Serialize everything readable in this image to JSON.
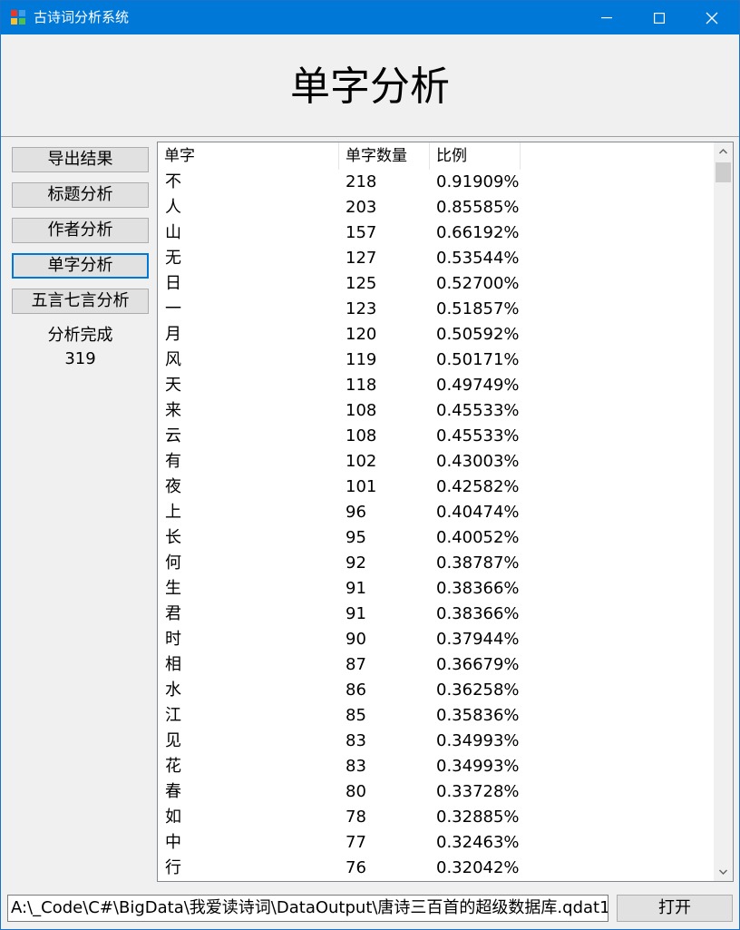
{
  "window": {
    "title": "古诗词分析系统"
  },
  "header": {
    "title": "单字分析"
  },
  "sidebar": {
    "buttons": [
      {
        "label": "导出结果"
      },
      {
        "label": "标题分析"
      },
      {
        "label": "作者分析"
      },
      {
        "label": "单字分析"
      },
      {
        "label": "五言七言分析"
      }
    ],
    "status_text": "分析完成",
    "status_count": "319"
  },
  "table": {
    "columns": [
      "单字",
      "单字数量",
      "比例"
    ],
    "rows": [
      [
        "不",
        "218",
        "0.91909%"
      ],
      [
        "人",
        "203",
        "0.85585%"
      ],
      [
        "山",
        "157",
        "0.66192%"
      ],
      [
        "无",
        "127",
        "0.53544%"
      ],
      [
        "日",
        "125",
        "0.52700%"
      ],
      [
        "一",
        "123",
        "0.51857%"
      ],
      [
        "月",
        "120",
        "0.50592%"
      ],
      [
        "风",
        "119",
        "0.50171%"
      ],
      [
        "天",
        "118",
        "0.49749%"
      ],
      [
        "来",
        "108",
        "0.45533%"
      ],
      [
        "云",
        "108",
        "0.45533%"
      ],
      [
        "有",
        "102",
        "0.43003%"
      ],
      [
        "夜",
        "101",
        "0.42582%"
      ],
      [
        "上",
        "96",
        "0.40474%"
      ],
      [
        "长",
        "95",
        "0.40052%"
      ],
      [
        "何",
        "92",
        "0.38787%"
      ],
      [
        "生",
        "91",
        "0.38366%"
      ],
      [
        "君",
        "91",
        "0.38366%"
      ],
      [
        "时",
        "90",
        "0.37944%"
      ],
      [
        "相",
        "87",
        "0.36679%"
      ],
      [
        "水",
        "86",
        "0.36258%"
      ],
      [
        "江",
        "85",
        "0.35836%"
      ],
      [
        "见",
        "83",
        "0.34993%"
      ],
      [
        "花",
        "83",
        "0.34993%"
      ],
      [
        "春",
        "80",
        "0.33728%"
      ],
      [
        "如",
        "78",
        "0.32885%"
      ],
      [
        "中",
        "77",
        "0.32463%"
      ],
      [
        "行",
        "76",
        "0.32042%"
      ]
    ]
  },
  "footer": {
    "path_value": "A:\\_Code\\C#\\BigData\\我爱读诗词\\DataOutput\\唐诗三百首的超级数据库.qdat1",
    "open_label": "打开"
  },
  "colors": {
    "titlebar": "#0078d7",
    "active_border": "#0078d7"
  },
  "icons": [
    "app-icon",
    "minimize-icon",
    "maximize-icon",
    "close-icon",
    "scroll-up-icon",
    "scroll-down-icon"
  ]
}
